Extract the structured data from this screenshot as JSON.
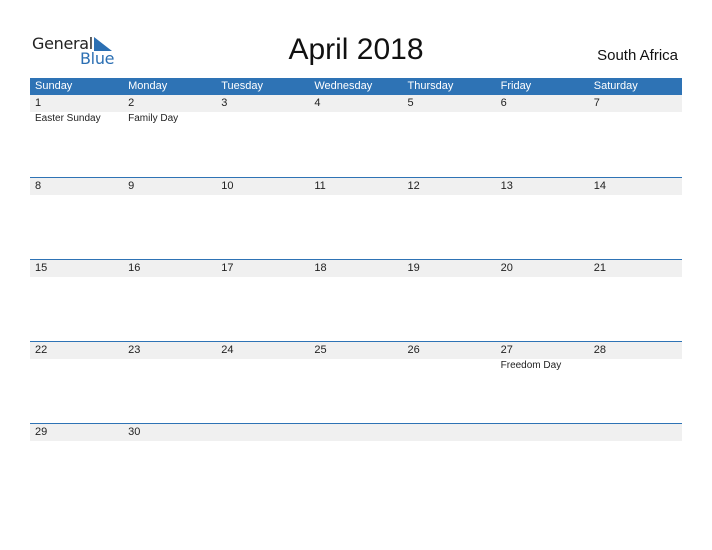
{
  "logo": {
    "general": "General",
    "blue": "Blue"
  },
  "title": "April 2018",
  "country": "South Africa",
  "colors": {
    "accent": "#2e73b5",
    "strip": "#f0f0f0"
  },
  "weekdays": [
    "Sunday",
    "Monday",
    "Tuesday",
    "Wednesday",
    "Thursday",
    "Friday",
    "Saturday"
  ],
  "weeks": [
    {
      "days": [
        "1",
        "2",
        "3",
        "4",
        "5",
        "6",
        "7"
      ],
      "events": [
        "Easter Sunday",
        "Family Day",
        "",
        "",
        "",
        "",
        ""
      ]
    },
    {
      "days": [
        "8",
        "9",
        "10",
        "11",
        "12",
        "13",
        "14"
      ],
      "events": [
        "",
        "",
        "",
        "",
        "",
        "",
        ""
      ]
    },
    {
      "days": [
        "15",
        "16",
        "17",
        "18",
        "19",
        "20",
        "21"
      ],
      "events": [
        "",
        "",
        "",
        "",
        "",
        "",
        ""
      ]
    },
    {
      "days": [
        "22",
        "23",
        "24",
        "25",
        "26",
        "27",
        "28"
      ],
      "events": [
        "",
        "",
        "",
        "",
        "",
        "Freedom Day",
        ""
      ]
    },
    {
      "days": [
        "29",
        "30",
        "",
        "",
        "",
        "",
        ""
      ],
      "events": [
        "",
        "",
        "",
        "",
        "",
        "",
        ""
      ]
    }
  ]
}
